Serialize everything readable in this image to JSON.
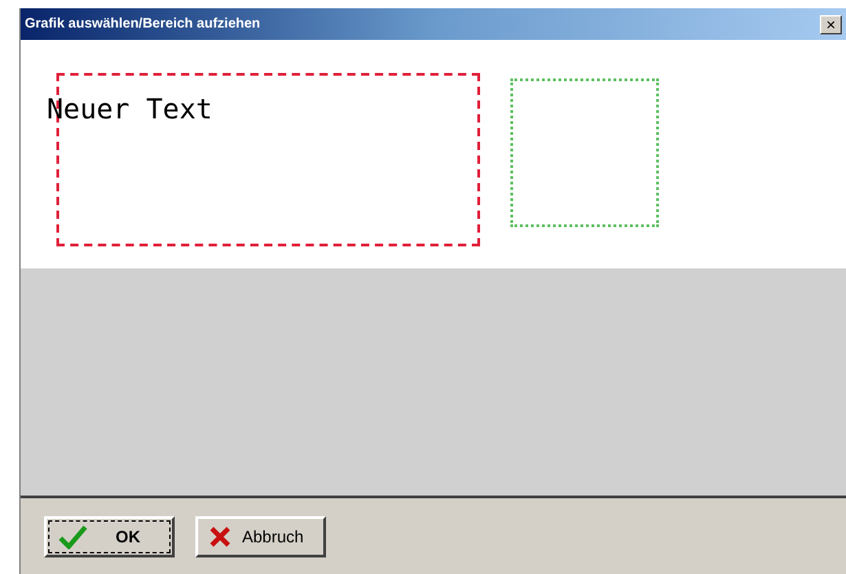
{
  "window": {
    "title": "Grafik auswählen/Bereich aufziehen",
    "close": "×"
  },
  "canvas": {
    "items": [
      {
        "kind": "text_frame",
        "text": "Neuer Text",
        "selected": true
      },
      {
        "kind": "area",
        "selected": false
      }
    ]
  },
  "buttons": [
    {
      "label": "OK",
      "kind": "ok",
      "default": true
    },
    {
      "label": "Abbruch",
      "kind": "cancel",
      "default": false
    }
  ]
}
